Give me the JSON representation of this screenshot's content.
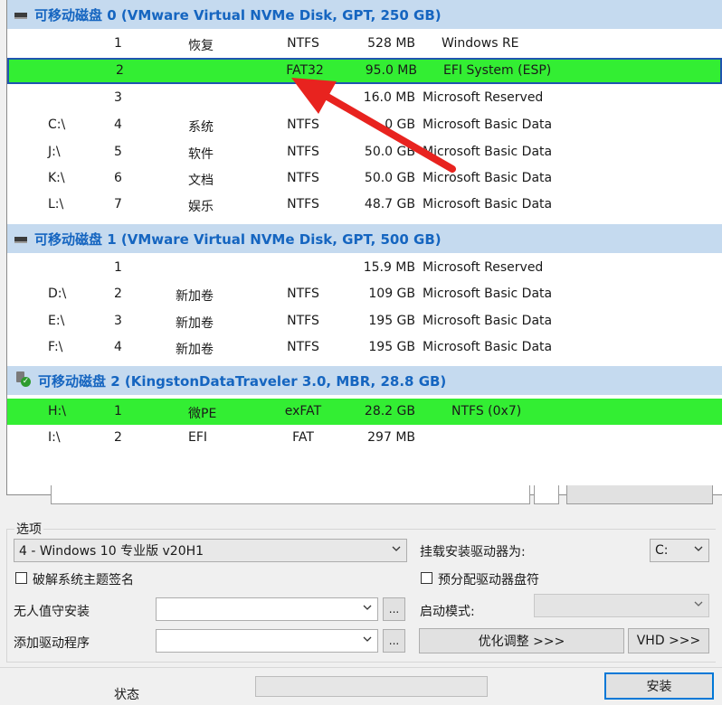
{
  "disks": [
    {
      "header": "可移动磁盘 0 (VMware Virtual NVMe Disk, GPT, 250 GB)",
      "icon": "hdd-icon",
      "partitions": [
        {
          "drive": "",
          "num": "1",
          "label": "恢复",
          "fs": "NTFS",
          "size": "528 MB",
          "type": "Windows RE"
        },
        {
          "drive": "",
          "num": "2",
          "label": "",
          "fs": "FAT32",
          "size": "95.0 MB",
          "type": "EFI System (ESP)",
          "state": "selected"
        },
        {
          "drive": "",
          "num": "3",
          "label": "",
          "fs": "",
          "size": "16.0 MB",
          "type": "Microsoft Reserved"
        },
        {
          "drive": "C:\\",
          "num": "4",
          "label": "系统",
          "fs": "NTFS",
          "size": "0 GB",
          "type": "Microsoft Basic Data"
        },
        {
          "drive": "J:\\",
          "num": "5",
          "label": "软件",
          "fs": "NTFS",
          "size": "50.0 GB",
          "type": "Microsoft Basic Data"
        },
        {
          "drive": "K:\\",
          "num": "6",
          "label": "文档",
          "fs": "NTFS",
          "size": "50.0 GB",
          "type": "Microsoft Basic Data"
        },
        {
          "drive": "L:\\",
          "num": "7",
          "label": "娱乐",
          "fs": "NTFS",
          "size": "48.7 GB",
          "type": "Microsoft Basic Data"
        }
      ]
    },
    {
      "header": "可移动磁盘 1 (VMware Virtual NVMe Disk, GPT, 500 GB)",
      "icon": "hdd-icon",
      "partitions": [
        {
          "drive": "",
          "num": "1",
          "label": "",
          "fs": "",
          "size": "15.9 MB",
          "type": "Microsoft Reserved"
        },
        {
          "drive": "D:\\",
          "num": "2",
          "label": "新加卷",
          "fs": "NTFS",
          "size": "109 GB",
          "type": "Microsoft Basic Data"
        },
        {
          "drive": "E:\\",
          "num": "3",
          "label": "新加卷",
          "fs": "NTFS",
          "size": "195 GB",
          "type": "Microsoft Basic Data"
        },
        {
          "drive": "F:\\",
          "num": "4",
          "label": "新加卷",
          "fs": "NTFS",
          "size": "195 GB",
          "type": "Microsoft Basic Data"
        }
      ]
    },
    {
      "header": "可移动磁盘 2 (KingstonDataTraveler 3.0, MBR, 28.8 GB)",
      "icon": "usb-drive-icon",
      "partitions": [
        {
          "drive": "H:\\",
          "num": "1",
          "label": "微PE",
          "fs": "exFAT",
          "size": "28.2 GB",
          "type": "NTFS (0x7)",
          "state": "highlighted"
        },
        {
          "drive": "I:\\",
          "num": "2",
          "label": "EFI",
          "fs": "FAT",
          "size": "297 MB",
          "type": ""
        }
      ]
    }
  ],
  "options": {
    "group_label": "选项",
    "edition_value": "4 - Windows 10 专业版 v20H1",
    "mount_label": "挂载安装驱动器为:",
    "mount_value": "C:",
    "crack_theme_label": "破解系统主题签名",
    "prealloc_label": "预分配驱动器盘符",
    "unattend_label": "无人值守安装",
    "unattend_value": "",
    "boot_mode_label": "启动模式:",
    "boot_mode_value": "",
    "add_driver_label": "添加驱动程序",
    "add_driver_value": "",
    "browse_label": "...",
    "optimize_label": "优化调整 >>>",
    "vhd_label": "VHD >>>"
  },
  "status": {
    "label": "状态",
    "install_label": "安装"
  },
  "colors": {
    "header_bg": "#c5daef",
    "header_text": "#1565c0",
    "highlight_green": "#33ee33",
    "selection_border": "#1f55b0",
    "arrow_red": "#e8231f"
  }
}
